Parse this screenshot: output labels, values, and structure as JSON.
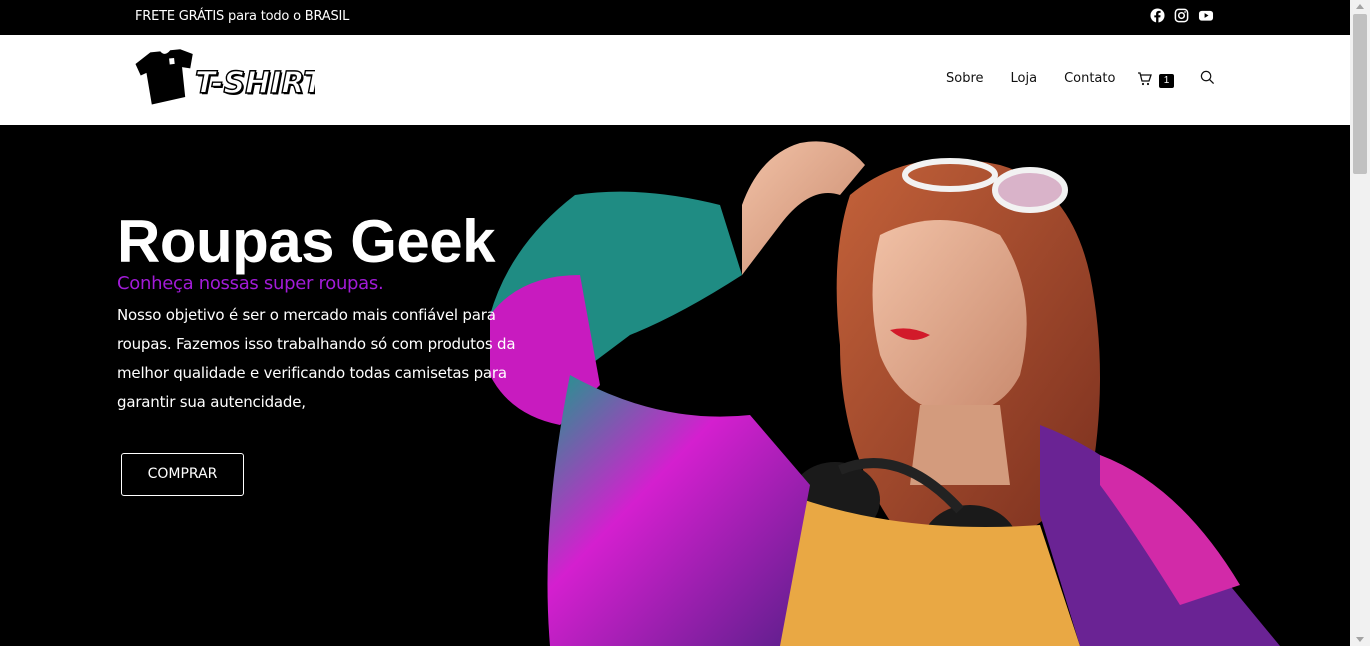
{
  "topbar": {
    "promo": "FRETE GRÁTIS para todo o BRASIL",
    "socials": [
      "facebook-icon",
      "instagram-icon",
      "youtube-icon"
    ]
  },
  "header": {
    "logo_text": "T-SHIRT",
    "nav": [
      "Sobre",
      "Loja",
      "Contato"
    ],
    "cart_count": "1"
  },
  "hero": {
    "title": "Roupas Geek",
    "subtitle": "Conheça nossas super roupas.",
    "text": "Nosso objetivo é ser o mercado mais confiável para roupas. Fazemos isso trabalhando só com produtos da melhor qualidade e  verificando todas camisetas para garantir sua autencidade,",
    "button": "COMPRAR",
    "subtitle_color": "#a21bd8"
  }
}
